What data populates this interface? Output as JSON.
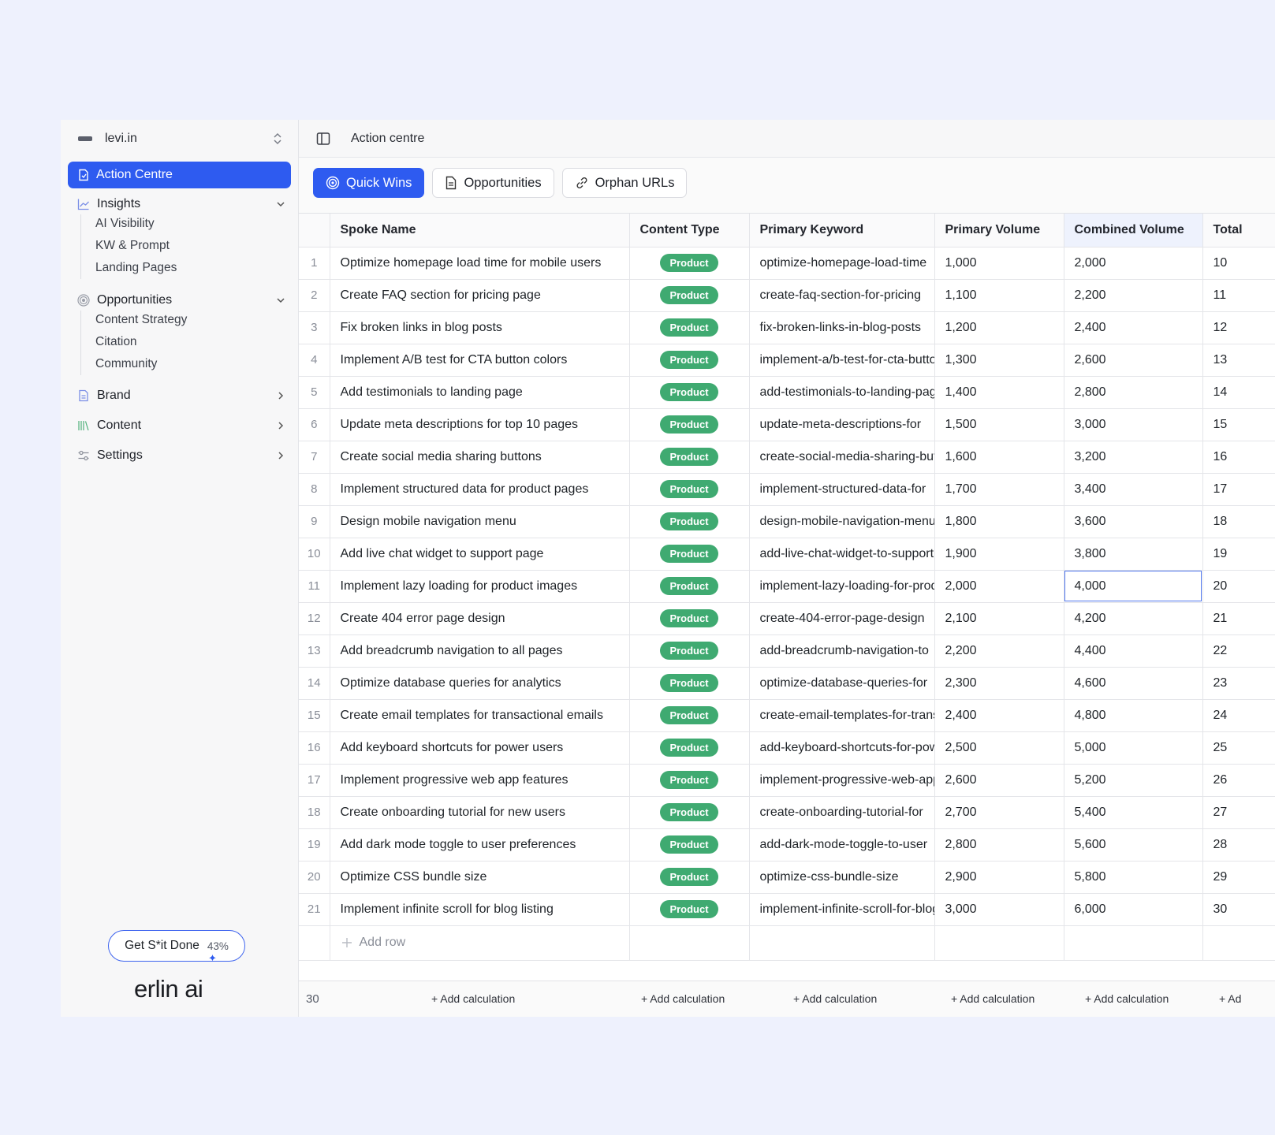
{
  "workspace": {
    "name": "levi.in"
  },
  "sidebar": {
    "active": "Action Centre",
    "insights": {
      "label": "Insights",
      "items": [
        "AI Visibility",
        "KW & Prompt",
        "Landing Pages"
      ]
    },
    "opportunities": {
      "label": "Opportunities",
      "items": [
        "Content Strategy",
        "Citation",
        "Community"
      ]
    },
    "brand": "Brand",
    "content": "Content",
    "settings": "Settings",
    "cta": {
      "label": "Get S*it Done",
      "progress": "43%"
    },
    "logo_text": "erlin ai",
    "logo_mark": "✦"
  },
  "header": {
    "title": "Action centre"
  },
  "tabs": [
    "Quick Wins",
    "Opportunities",
    "Orphan URLs"
  ],
  "table": {
    "columns": [
      "Spoke Name",
      "Content Type",
      "Primary Keyword",
      "Primary Volume",
      "Combined Volume",
      "Total"
    ],
    "rows": [
      {
        "n": "1",
        "name": "Optimize homepage load time for mobile users",
        "type": "Product",
        "kw": "optimize-homepage-load-time",
        "pv": "1,000",
        "cv": "2,000",
        "t": "10"
      },
      {
        "n": "2",
        "name": "Create FAQ section for pricing page",
        "type": "Product",
        "kw": "create-faq-section-for-pricing",
        "pv": "1,100",
        "cv": "2,200",
        "t": "11"
      },
      {
        "n": "3",
        "name": "Fix broken links in blog posts",
        "type": "Product",
        "kw": "fix-broken-links-in-blog-posts",
        "pv": "1,200",
        "cv": "2,400",
        "t": "12"
      },
      {
        "n": "4",
        "name": "Implement A/B test for CTA button colors",
        "type": "Product",
        "kw": "implement-a/b-test-for-cta-button",
        "pv": "1,300",
        "cv": "2,600",
        "t": "13"
      },
      {
        "n": "5",
        "name": "Add testimonials to landing page",
        "type": "Product",
        "kw": "add-testimonials-to-landing-page",
        "pv": "1,400",
        "cv": "2,800",
        "t": "14"
      },
      {
        "n": "6",
        "name": "Update meta descriptions for top 10 pages",
        "type": "Product",
        "kw": "update-meta-descriptions-for",
        "pv": "1,500",
        "cv": "3,000",
        "t": "15"
      },
      {
        "n": "7",
        "name": "Create social media sharing buttons",
        "type": "Product",
        "kw": "create-social-media-sharing-buttons",
        "pv": "1,600",
        "cv": "3,200",
        "t": "16"
      },
      {
        "n": "8",
        "name": "Implement structured data for product pages",
        "type": "Product",
        "kw": "implement-structured-data-for",
        "pv": "1,700",
        "cv": "3,400",
        "t": "17"
      },
      {
        "n": "9",
        "name": "Design mobile navigation menu",
        "type": "Product",
        "kw": "design-mobile-navigation-menu",
        "pv": "1,800",
        "cv": "3,600",
        "t": "18"
      },
      {
        "n": "10",
        "name": "Add live chat widget to support page",
        "type": "Product",
        "kw": "add-live-chat-widget-to-support",
        "pv": "1,900",
        "cv": "3,800",
        "t": "19"
      },
      {
        "n": "11",
        "name": "Implement lazy loading for product images",
        "type": "Product",
        "kw": "implement-lazy-loading-for-product",
        "pv": "2,000",
        "cv": "4,000",
        "t": "20"
      },
      {
        "n": "12",
        "name": "Create 404 error page design",
        "type": "Product",
        "kw": "create-404-error-page-design",
        "pv": "2,100",
        "cv": "4,200",
        "t": "21"
      },
      {
        "n": "13",
        "name": "Add breadcrumb navigation to all pages",
        "type": "Product",
        "kw": "add-breadcrumb-navigation-to",
        "pv": "2,200",
        "cv": "4,400",
        "t": "22"
      },
      {
        "n": "14",
        "name": "Optimize database queries for analytics",
        "type": "Product",
        "kw": "optimize-database-queries-for",
        "pv": "2,300",
        "cv": "4,600",
        "t": "23"
      },
      {
        "n": "15",
        "name": "Create email templates for transactional emails",
        "type": "Product",
        "kw": "create-email-templates-for-transactional",
        "pv": "2,400",
        "cv": "4,800",
        "t": "24"
      },
      {
        "n": "16",
        "name": "Add keyboard shortcuts for power users",
        "type": "Product",
        "kw": "add-keyboard-shortcuts-for-power",
        "pv": "2,500",
        "cv": "5,000",
        "t": "25"
      },
      {
        "n": "17",
        "name": "Implement progressive web app features",
        "type": "Product",
        "kw": "implement-progressive-web-app",
        "pv": "2,600",
        "cv": "5,200",
        "t": "26"
      },
      {
        "n": "18",
        "name": "Create onboarding tutorial for new users",
        "type": "Product",
        "kw": "create-onboarding-tutorial-for",
        "pv": "2,700",
        "cv": "5,400",
        "t": "27"
      },
      {
        "n": "19",
        "name": "Add dark mode toggle to user preferences",
        "type": "Product",
        "kw": "add-dark-mode-toggle-to-user",
        "pv": "2,800",
        "cv": "5,600",
        "t": "28"
      },
      {
        "n": "20",
        "name": "Optimize CSS bundle size",
        "type": "Product",
        "kw": "optimize-css-bundle-size",
        "pv": "2,900",
        "cv": "5,800",
        "t": "29"
      },
      {
        "n": "21",
        "name": "Implement infinite scroll for blog listing",
        "type": "Product",
        "kw": "implement-infinite-scroll-for-blog",
        "pv": "3,000",
        "cv": "6,000",
        "t": "30"
      }
    ],
    "selected_cell": {
      "row": "11",
      "column": "Combined Volume"
    },
    "add_row_label": "Add row"
  },
  "footer": {
    "count": "30",
    "calc_label": "+ Add calculation",
    "calc_truncated": "+ Ad"
  },
  "colors": {
    "accent": "#2e5bf0",
    "badge": "#3faa71",
    "background": "#eef1fd"
  }
}
